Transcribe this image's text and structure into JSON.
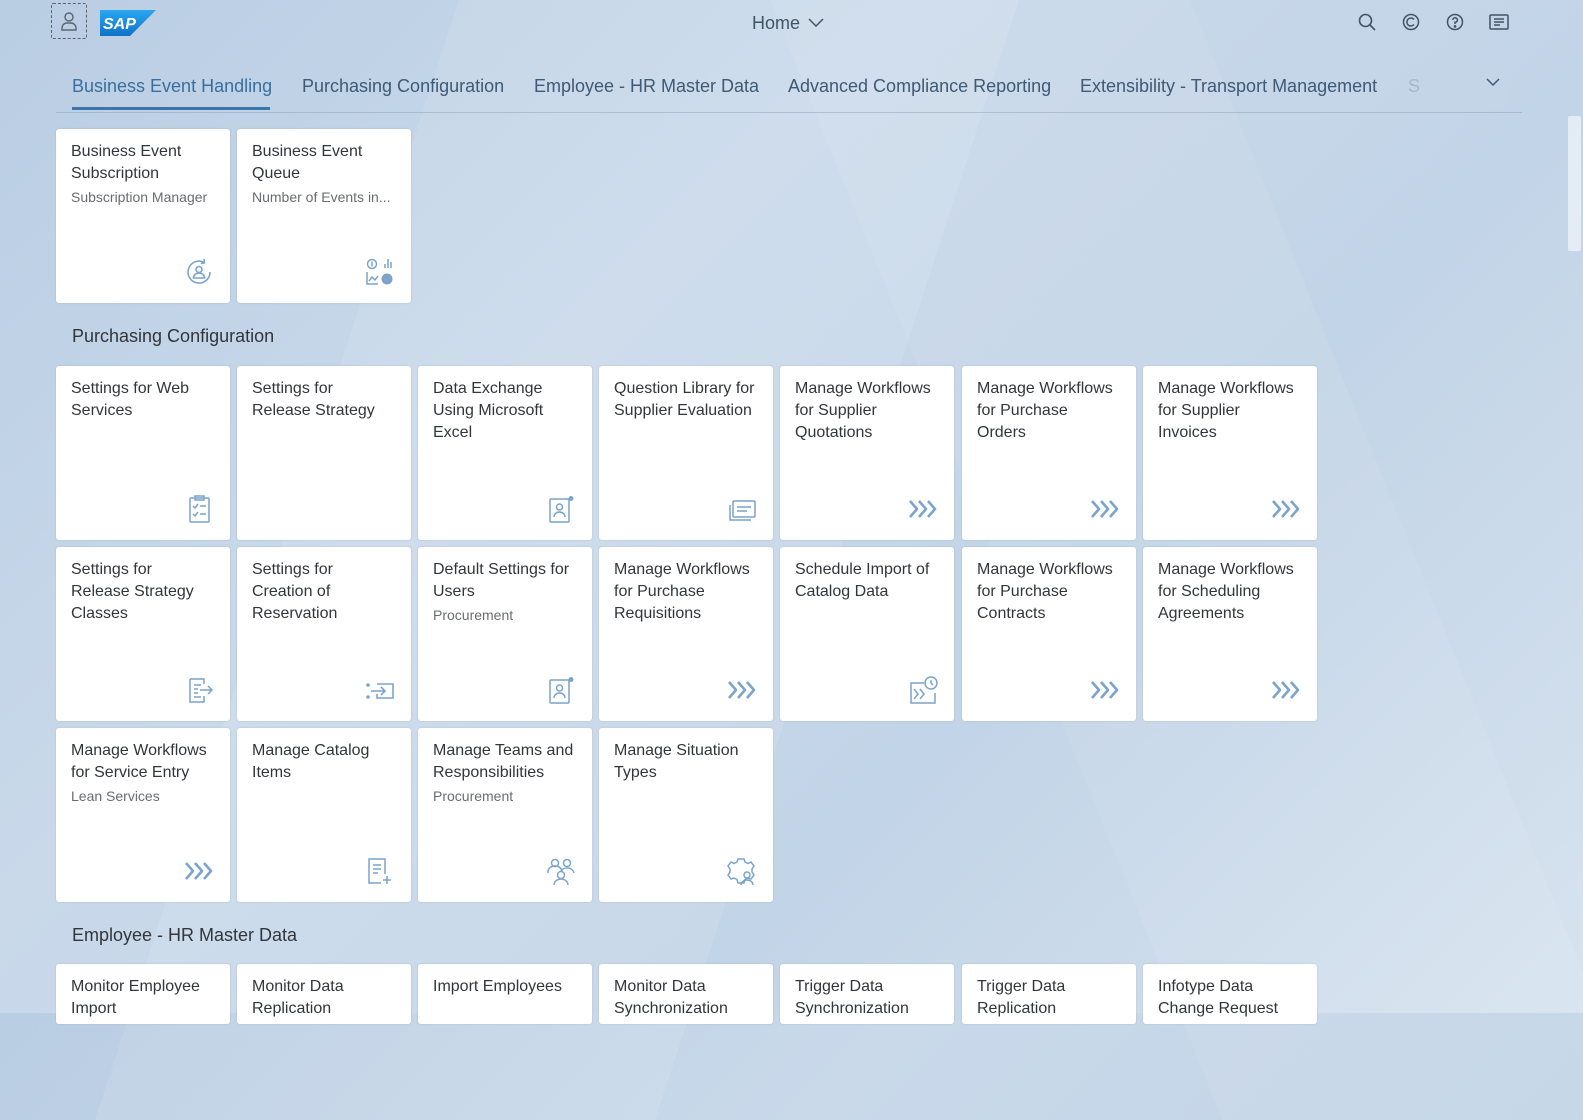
{
  "header": {
    "title": "Home",
    "logo_text": "SAP",
    "icons": [
      "user-icon",
      "search-icon",
      "copilot-icon",
      "help-icon",
      "notifications-icon"
    ]
  },
  "tabs": [
    {
      "label": "Business Event Handling",
      "active": true
    },
    {
      "label": "Purchasing Configuration",
      "active": false
    },
    {
      "label": "Employee - HR Master Data",
      "active": false
    },
    {
      "label": "Advanced Compliance Reporting",
      "active": false
    },
    {
      "label": "Extensibility - Transport Management",
      "active": false
    },
    {
      "label": "S",
      "active": false
    }
  ],
  "sections": {
    "business_event": {
      "tiles": [
        {
          "title": "Business Event Subscription",
          "subtitle": "Subscription Manager",
          "icon": "subscription-icon"
        },
        {
          "title": "Business Event Queue",
          "subtitle": "Number of Events in...",
          "icon": "analytics-icon"
        }
      ]
    },
    "purchasing": {
      "title": "Purchasing Configuration",
      "tiles": [
        {
          "title": "Settings for Web Services",
          "subtitle": "",
          "icon": "checklist-icon"
        },
        {
          "title": "Settings for Release Strategy",
          "subtitle": "",
          "icon": ""
        },
        {
          "title": "Data Exchange Using Microsoft Excel",
          "subtitle": "",
          "icon": "user-settings-icon"
        },
        {
          "title": "Question Library for Supplier Evaluation",
          "subtitle": "",
          "icon": "card-stack-icon"
        },
        {
          "title": "Manage Workflows for Supplier Quotations",
          "subtitle": "",
          "icon": "workflow-icon"
        },
        {
          "title": "Manage Workflows for Purchase Orders",
          "subtitle": "",
          "icon": "workflow-icon"
        },
        {
          "title": "Manage Workflows for Supplier Invoices",
          "subtitle": "",
          "icon": "workflow-icon"
        },
        {
          "title": "Settings for Release Strategy Classes",
          "subtitle": "",
          "icon": "document-arrow-icon"
        },
        {
          "title": "Settings for Creation of Reservation",
          "subtitle": "",
          "icon": "list-enter-icon"
        },
        {
          "title": "Default Settings for Users",
          "subtitle": "Procurement",
          "icon": "user-settings-icon"
        },
        {
          "title": "Manage Workflows for Purchase Requisitions",
          "subtitle": "",
          "icon": "workflow-icon"
        },
        {
          "title": "Schedule Import of Catalog Data",
          "subtitle": "",
          "icon": "scheduled-workflow-icon"
        },
        {
          "title": "Manage Workflows for Purchase Contracts",
          "subtitle": "",
          "icon": "workflow-icon"
        },
        {
          "title": "Manage Workflows for Scheduling Agreements",
          "subtitle": "",
          "icon": "workflow-icon"
        },
        {
          "title": "Manage Workflows for Service Entry",
          "subtitle": "Lean Services",
          "icon": "workflow-icon"
        },
        {
          "title": "Manage Catalog Items",
          "subtitle": "",
          "icon": "add-document-icon"
        },
        {
          "title": "Manage Teams and Responsibilities",
          "subtitle": "Procurement",
          "icon": "team-icon"
        },
        {
          "title": "Manage Situation Types",
          "subtitle": "",
          "icon": "user-gear-icon"
        }
      ]
    },
    "employee": {
      "title": "Employee - HR Master Data",
      "tiles": [
        {
          "title": "Monitor Employee Import"
        },
        {
          "title": "Monitor Data Replication"
        },
        {
          "title": "Import Employees"
        },
        {
          "title": "Monitor Data Synchronization"
        },
        {
          "title": "Trigger Data Synchronization"
        },
        {
          "title": "Trigger Data Replication"
        },
        {
          "title": "Infotype Data Change Request"
        }
      ]
    }
  },
  "colors": {
    "accent": "#3a76ab",
    "icon": "#7ba4cc",
    "tab_text": "#3f5a74"
  }
}
